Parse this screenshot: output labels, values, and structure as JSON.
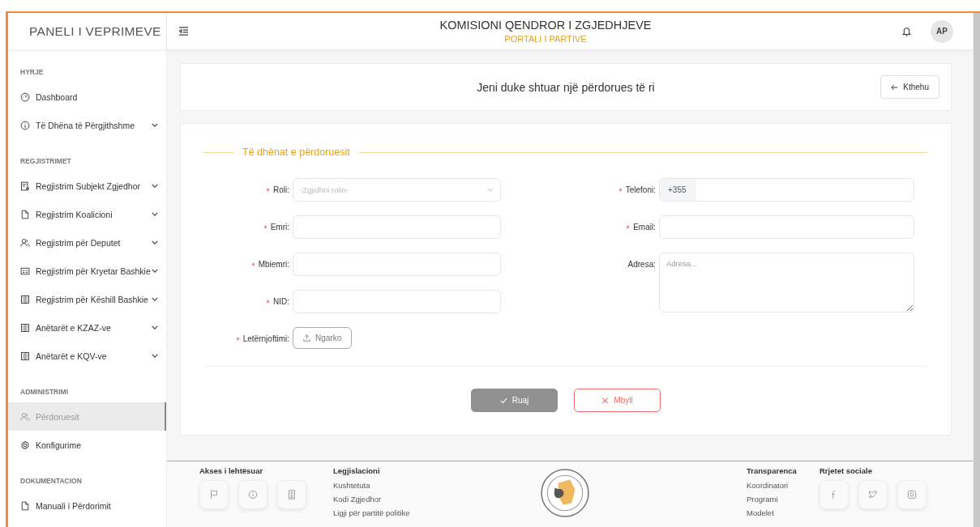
{
  "brand": "PANELI I VEPRIMEVE",
  "header": {
    "title": "KOMISIONI QENDROR I ZGJEDHJEVE",
    "subtitle": "PORTALI I PARTIVE",
    "avatar": "AP"
  },
  "sidebar": {
    "sections": [
      {
        "title": "HYRJE",
        "items": [
          {
            "label": "Dashboard",
            "kind": "gauge",
            "expandable": false,
            "selected": false
          },
          {
            "label": "Të Dhëna të Përgjithshme",
            "kind": "info",
            "expandable": true,
            "selected": false
          }
        ]
      },
      {
        "title": "REGJISTRIMET",
        "items": [
          {
            "label": "Regjistrim Subjekt Zgjedhor",
            "kind": "form",
            "expandable": true,
            "selected": false
          },
          {
            "label": "Regjistrim Koalicioni",
            "kind": "doc",
            "expandable": true,
            "selected": false
          },
          {
            "label": "Regjistrim për Deputet",
            "kind": "users",
            "expandable": true,
            "selected": false
          },
          {
            "label": "Regjistrim për Kryetar Bashkie",
            "kind": "card",
            "expandable": true,
            "selected": false
          },
          {
            "label": "Regjistrim për Këshill Bashkie",
            "kind": "building",
            "expandable": true,
            "selected": false
          },
          {
            "label": "Anëtarët e KZAZ-ve",
            "kind": "building",
            "expandable": true,
            "selected": false
          },
          {
            "label": "Anëtarët e KQV-ve",
            "kind": "building",
            "expandable": true,
            "selected": false
          }
        ]
      },
      {
        "title": "ADMINISTRIMI",
        "items": [
          {
            "label": "Përdoruesit",
            "kind": "users",
            "expandable": false,
            "selected": true
          },
          {
            "label": "Konfigurime",
            "kind": "gear",
            "expandable": false,
            "selected": false
          }
        ]
      },
      {
        "title": "DOKUMENTACION",
        "items": [
          {
            "label": "Manuali i Përdorimit",
            "kind": "doc",
            "expandable": false,
            "selected": false
          }
        ]
      }
    ]
  },
  "page_title": "Jeni duke shtuar një përdorues të ri",
  "back_button": "Kthehu",
  "form": {
    "legend": "Të dhënat e përdoruesit",
    "left": [
      {
        "kind": "select",
        "label": "Roli:",
        "required": true,
        "placeholder": "-Zgjidhni rolin-"
      },
      {
        "kind": "text",
        "label": "Emri:",
        "required": true
      },
      {
        "kind": "text",
        "label": "Mbiemri:",
        "required": true
      },
      {
        "kind": "text",
        "label": "NID:",
        "required": true
      },
      {
        "kind": "upload",
        "label": "Letërnjoftimi:",
        "required": true,
        "button": "Ngarko"
      }
    ],
    "right": [
      {
        "kind": "phone",
        "label": "Telefoni:",
        "required": true,
        "prefix": "+355"
      },
      {
        "kind": "text",
        "label": "Email:",
        "required": true
      },
      {
        "kind": "textarea",
        "label": "Adresa:",
        "required": false,
        "placeholder": "Adresa..."
      }
    ],
    "save": "Ruaj",
    "close": "Mbyll"
  },
  "footer": {
    "accessibility": {
      "title": "Akses i lehtësuar"
    },
    "legislation": {
      "title": "Legjislacioni",
      "links": [
        "Kushtetuta",
        "Kodi Zgjedhor",
        "Ligji për partitë politike"
      ]
    },
    "transparency": {
      "title": "Transparenca",
      "links": [
        "Koordinatori",
        "Programi",
        "Modelet"
      ]
    },
    "social": {
      "title": "Rrjetet sociale"
    }
  }
}
